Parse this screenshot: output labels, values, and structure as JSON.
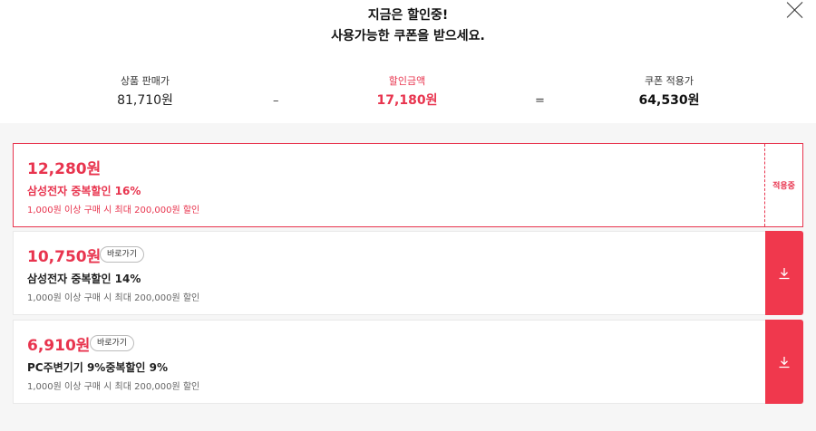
{
  "header": {
    "line1": "지금은 할인중!",
    "line2": "사용가능한 쿠폰을 받으세요."
  },
  "summary": {
    "original_label": "상품 판매가",
    "original_value": "81,710원",
    "minus": "–",
    "discount_label": "할인금액",
    "discount_value": "17,180원",
    "equals": "=",
    "final_label": "쿠폰 적용가",
    "final_value": "64,530원"
  },
  "coupons": [
    {
      "amount": "12,280원",
      "name": "삼성전자 중복할인 16%",
      "condition": "1,000원 이상 구매 시 최대 200,000원 할인",
      "status": "적용중"
    },
    {
      "amount": "10,750원",
      "goto_label": "바로가기",
      "name": "삼성전자 중복할인 14%",
      "condition": "1,000원 이상 구매 시 최대 200,000원 할인",
      "action_icon": "download-icon"
    },
    {
      "amount": "6,910원",
      "goto_label": "바로가기",
      "name": "PC주변기기 9%중복할인 9%",
      "condition": "1,000원 이상 구매 시 최대 200,000원 할인",
      "action_icon": "download-icon"
    }
  ],
  "colors": {
    "accent": "#e8344e",
    "download_bg": "#f0384d",
    "list_bg": "#f6f6f6"
  }
}
